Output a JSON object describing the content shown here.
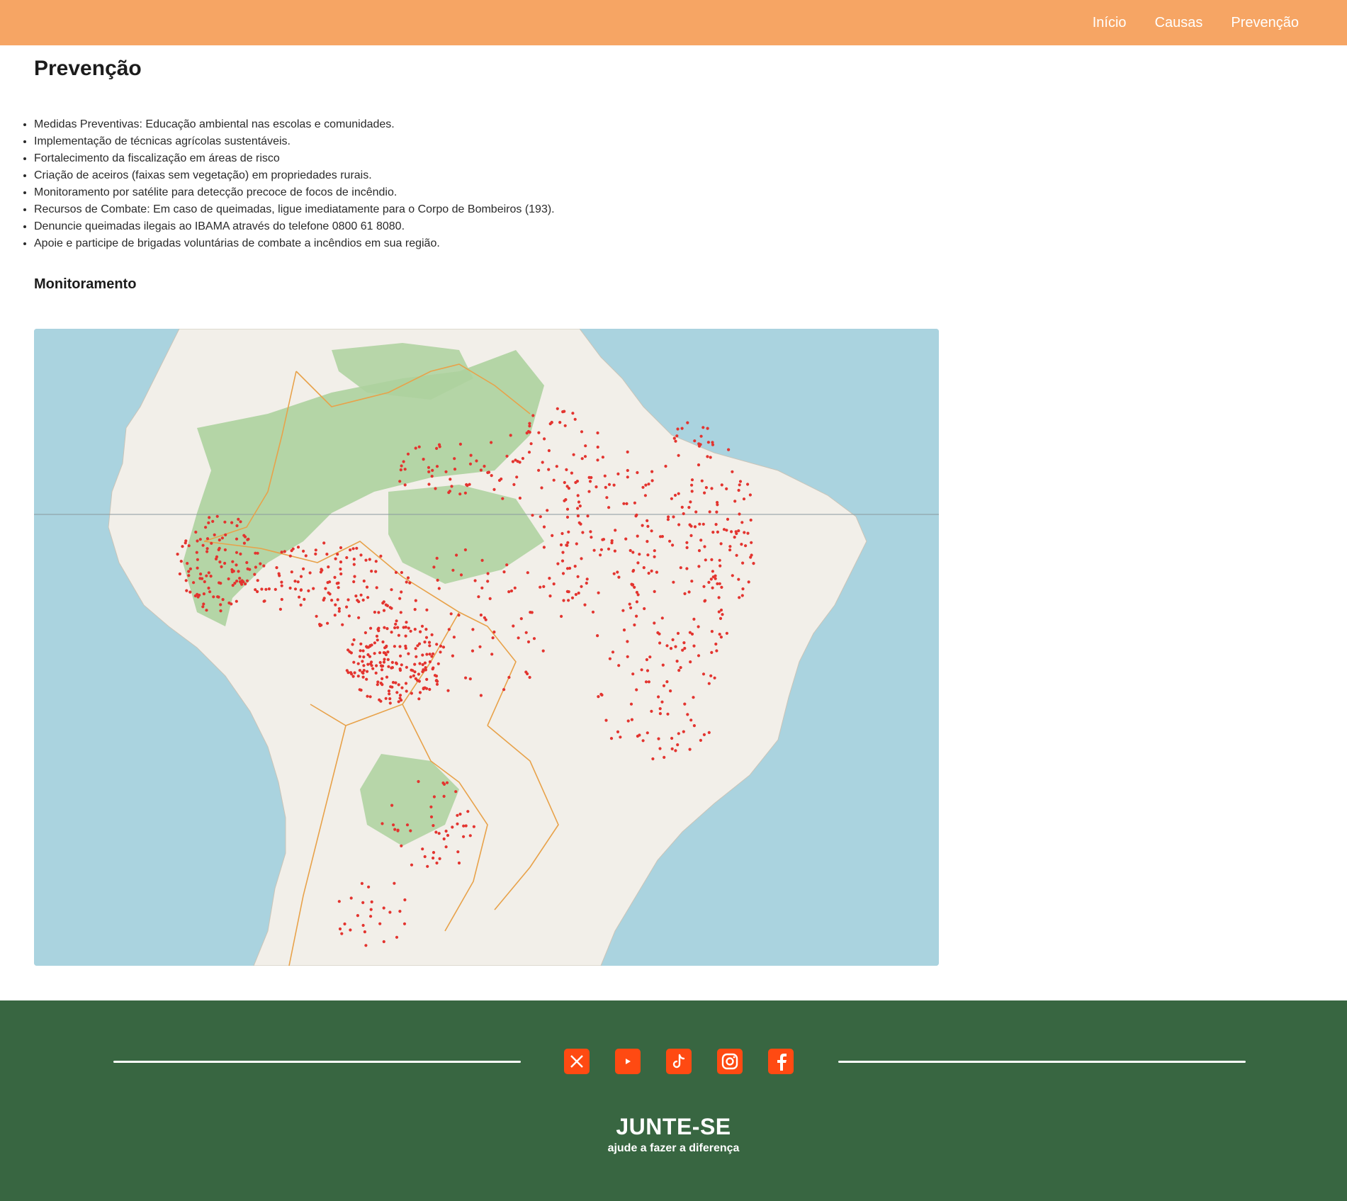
{
  "nav": {
    "links": [
      "Início",
      "Causas",
      "Prevenção"
    ]
  },
  "page": {
    "title": "Prevenção",
    "items": [
      "Medidas Preventivas: Educação ambiental nas escolas e comunidades.",
      "Implementação de técnicas agrícolas sustentáveis.",
      "Fortalecimento da fiscalização em áreas de risco",
      "Criação de aceiros (faixas sem vegetação) em propriedades rurais.",
      "Monitoramento por satélite para detecção precoce de focos de incêndio.",
      "Recursos de Combate: Em caso de queimadas, ligue imediatamente para o Corpo de Bombeiros (193).",
      "Denuncie queimadas ilegais ao IBAMA através do telefone 0800 61 8080.",
      "Apoie e participe de brigadas voluntárias de combate a incêndios em sua região."
    ],
    "section_title": "Monitoramento"
  },
  "map": {
    "description_icon": "fire-hotspot-map",
    "colors": {
      "ocean": "#aad3df",
      "land": "#f2efe9",
      "forest": "#add19e",
      "border": "#e8a24a",
      "hotspot": "#e3342f"
    }
  },
  "footer": {
    "socials": [
      "x-icon",
      "youtube-icon",
      "tiktok-icon",
      "instagram-icon",
      "facebook-icon"
    ],
    "title": "JUNTE-SE",
    "subtitle": "ajude a fazer a diferença",
    "colors": {
      "background": "#386641",
      "icon": "#ff4a12"
    }
  }
}
